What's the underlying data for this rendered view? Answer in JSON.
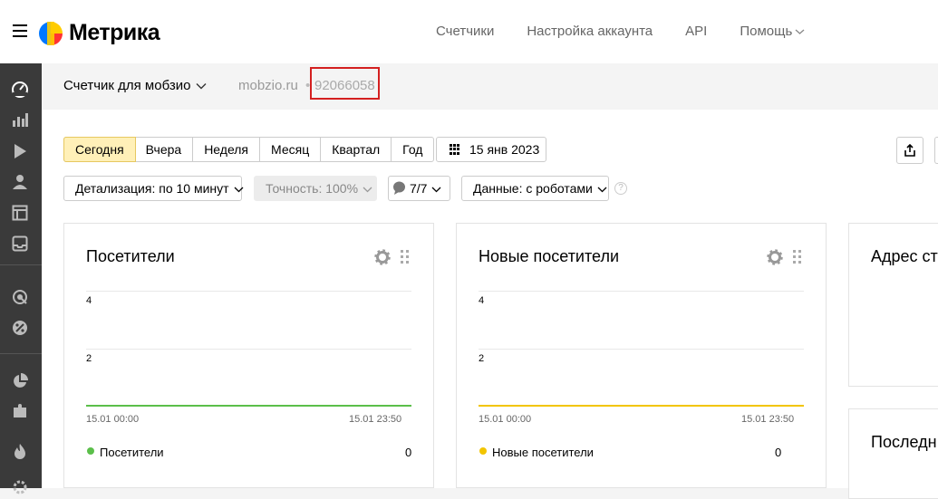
{
  "app": {
    "name": "Метрика"
  },
  "topnav": {
    "items": [
      "Счетчики",
      "Настройка аккаунта",
      "API",
      "Помощь"
    ]
  },
  "counter": {
    "name": "Счетчик для мобзио",
    "site": "mobzio.ru",
    "separator": "•",
    "id": "92066058"
  },
  "periods": [
    "Сегодня",
    "Вчера",
    "Неделя",
    "Месяц",
    "Квартал",
    "Год"
  ],
  "active_period": "Сегодня",
  "date_label": "15 янв 2023",
  "controls": {
    "detail": "Детализация: по 10 минут",
    "accuracy": "Точность: 100%",
    "segments": "7/7",
    "data": "Данные: с роботами",
    "help": "?"
  },
  "widgets": [
    {
      "title": "Посетители",
      "y_ticks": [
        "4",
        "2"
      ],
      "x_start": "15.01 00:00",
      "x_end": "15.01 23:50",
      "legend": "Посетители",
      "value": "0",
      "color": "#5bbf4a"
    },
    {
      "title": "Новые посетители",
      "y_ticks": [
        "4",
        "2"
      ],
      "x_start": "15.01 00:00",
      "x_end": "15.01 23:50",
      "legend": "Новые посетители",
      "value": "0",
      "color": "#f2c500"
    }
  ],
  "side_widgets": [
    "Адрес ст",
    "Последн"
  ],
  "icons": {
    "sidebar": [
      "dashboard-icon",
      "reports-icon",
      "webvisor-icon",
      "audience-icon",
      "maps-icon",
      "inbox-icon",
      "goals-icon",
      "percent-icon",
      "pie-chart-icon",
      "puzzle-icon",
      "fire-icon",
      "settings-icon"
    ],
    "toolbar": [
      "calendar-icon",
      "share-icon",
      "gear-icon",
      "drag-icon",
      "speech-bubble-icon"
    ]
  },
  "chart_data": [
    {
      "type": "line",
      "title": "Посетители",
      "x": [
        "15.01 00:00",
        "15.01 23:50"
      ],
      "series": [
        {
          "name": "Посетители",
          "values": [
            0,
            0
          ]
        }
      ],
      "ylim": [
        0,
        4
      ],
      "yticks": [
        2,
        4
      ]
    },
    {
      "type": "line",
      "title": "Новые посетители",
      "x": [
        "15.01 00:00",
        "15.01 23:50"
      ],
      "series": [
        {
          "name": "Новые посетители",
          "values": [
            0,
            0
          ]
        }
      ],
      "ylim": [
        0,
        4
      ],
      "yticks": [
        2,
        4
      ]
    }
  ]
}
